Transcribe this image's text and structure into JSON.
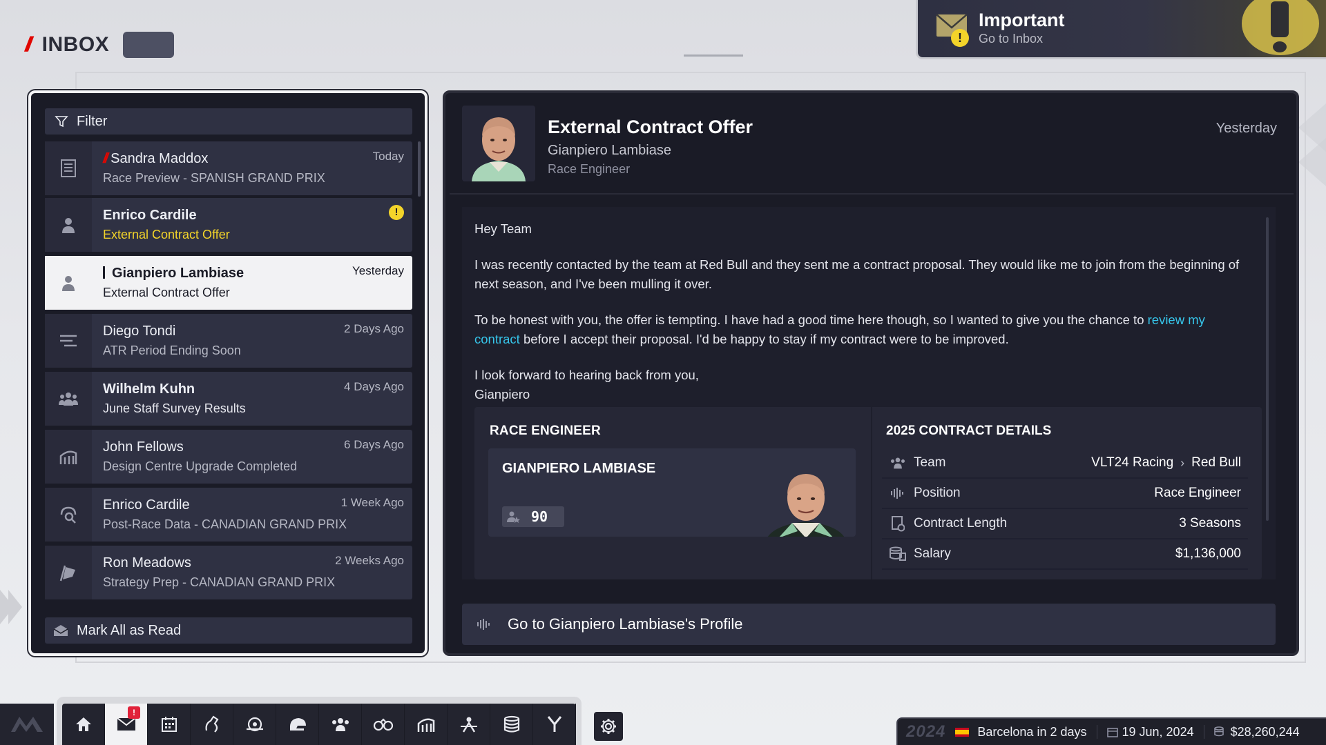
{
  "header": {
    "title": "INBOX"
  },
  "notification": {
    "title": "Important",
    "subtitle": "Go to Inbox"
  },
  "filter": {
    "label": "Filter"
  },
  "messages": [
    {
      "sender": "Sandra Maddox",
      "subject": "Race Preview - SPANISH GRAND PRIX",
      "time": "Today",
      "icon": "newspaper-icon",
      "tag": "//",
      "unread": false
    },
    {
      "sender": "Enrico Cardile",
      "subject": "External Contract Offer",
      "time": "",
      "icon": "person-icon",
      "unread": true,
      "important": true
    },
    {
      "sender": "Gianpiero Lambiase",
      "subject": "External Contract Offer",
      "time": "Yesterday",
      "icon": "person-icon",
      "selected": true,
      "unread": true
    },
    {
      "sender": "Diego Tondi",
      "subject": "ATR Period Ending Soon",
      "time": "2 Days Ago",
      "icon": "sliders-icon",
      "unread": false
    },
    {
      "sender": "Wilhelm Kuhn",
      "subject": "June Staff Survey Results",
      "time": "4 Days Ago",
      "icon": "group-icon",
      "unread": true
    },
    {
      "sender": "John Fellows",
      "subject": "Design Centre Upgrade Completed",
      "time": "6 Days Ago",
      "icon": "building-icon",
      "unread": false
    },
    {
      "sender": "Enrico Cardile",
      "subject": "Post-Race Data - CANADIAN GRAND PRIX",
      "time": "1 Week Ago",
      "icon": "search-data-icon",
      "unread": false
    },
    {
      "sender": "Ron Meadows",
      "subject": "Strategy Prep - CANADIAN GRAND PRIX",
      "time": "2 Weeks Ago",
      "icon": "flag-icon",
      "unread": false
    }
  ],
  "mark_all": {
    "label": "Mark All as Read"
  },
  "detail": {
    "title": "External Contract Offer",
    "from": "Gianpiero Lambiase",
    "role": "Race Engineer",
    "date": "Yesterday",
    "greeting": "Hey Team",
    "para1": "I was recently contacted by the team at Red Bull and they sent me a contract proposal. They would like me to join from the beginning of next season, and I've been mulling it over.",
    "para2_before": "To be honest with you, the offer is tempting. I have had a good time here though, so I wanted to give you the chance to ",
    "para2_link": "review my contract",
    "para2_after": " before I accept their proposal. I'd be happy to stay if my contract were to be improved.",
    "closing": "I look forward to hearing back from you,",
    "signature": "Gianpiero",
    "card": {
      "left_title": "RACE ENGINEER",
      "name": "GIANPIERO LAMBIASE",
      "rating": "90",
      "right_title": "2025 CONTRACT DETAILS",
      "rows": [
        {
          "label": "Team",
          "value_from": "VLT24 Racing",
          "value_to": "Red Bull",
          "icon": "group-icon"
        },
        {
          "label": "Position",
          "value": "Race Engineer",
          "icon": "waveform-icon"
        },
        {
          "label": "Contract Length",
          "value": "3 Seasons",
          "icon": "contract-icon"
        },
        {
          "label": "Salary",
          "value": "$1,136,000",
          "icon": "coins-icon"
        }
      ]
    },
    "profile_button": "Go to Gianpiero Lambiase's Profile"
  },
  "nav": {
    "items": [
      "home-icon",
      "mail-icon",
      "calendar-icon",
      "research-icon",
      "car-icon",
      "helmet-icon",
      "staff-icon",
      "scouting-icon",
      "facilities-icon",
      "pitcrew-icon",
      "finance-icon",
      "sponsor-icon"
    ],
    "mail_badge": "!"
  },
  "status": {
    "year": "2024",
    "location": "Barcelona in 2 days",
    "date": "19 Jun, 2024",
    "budget": "$28,260,244"
  }
}
